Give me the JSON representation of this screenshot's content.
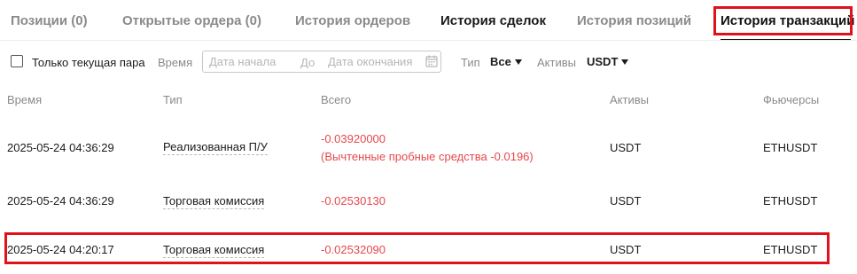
{
  "tabs": [
    {
      "label": "Позиции (0)"
    },
    {
      "label": "Открытые ордера (0)"
    },
    {
      "label": "История ордеров"
    },
    {
      "label": "История сделок"
    },
    {
      "label": "История позиций"
    },
    {
      "label": "История транзакций"
    }
  ],
  "filters": {
    "current_pair_label": "Только текущая пара",
    "time_label": "Время",
    "start_placeholder": "Дата начала",
    "to_label": "До",
    "end_placeholder": "Дата окончания",
    "type_label": "Тип",
    "type_value": "Все",
    "assets_label": "Активы",
    "assets_value": "USDT"
  },
  "table": {
    "headers": [
      "Время",
      "Тип",
      "Всего",
      "Активы",
      "Фьючерсы"
    ],
    "rows": [
      {
        "time": "2025-05-24 04:36:29",
        "type": "Реализованная П/У",
        "total": "-0.03920000",
        "note": "(Вычтенные пробные средства -0.0196)",
        "asset": "USDT",
        "futures": "ETHUSDT"
      },
      {
        "time": "2025-05-24 04:36:29",
        "type": "Торговая комиссия",
        "total": "-0.02530130",
        "asset": "USDT",
        "futures": "ETHUSDT"
      },
      {
        "time": "2025-05-24 04:20:17",
        "type": "Торговая комиссия",
        "total": "-0.02532090",
        "asset": "USDT",
        "futures": "ETHUSDT"
      }
    ]
  },
  "colors": {
    "accent_red": "#e0111b",
    "negative": "#e5484d",
    "muted": "#8a8a8a"
  }
}
